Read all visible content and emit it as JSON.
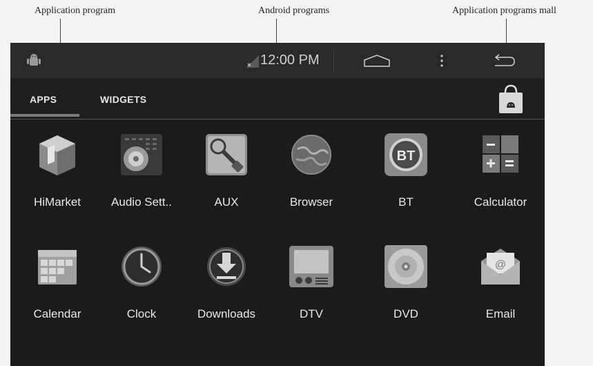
{
  "callouts": {
    "application_program": "Application program",
    "android_programs": "Android programs",
    "app_store": "Application programs mall"
  },
  "statusbar": {
    "time": "12:00 PM",
    "icons": [
      "android-debug-icon",
      "no-signal-icon",
      "home-icon",
      "menu-dots-icon",
      "back-icon"
    ]
  },
  "tabs": [
    {
      "label": "APPS",
      "selected": true
    },
    {
      "label": "WIDGETS",
      "selected": false
    }
  ],
  "store_icon": "shopping-bag-icon",
  "apps": [
    {
      "label": "HiMarket",
      "icon": "himarket-icon"
    },
    {
      "label": "Audio Sett..",
      "icon": "audio-settings-icon"
    },
    {
      "label": "AUX",
      "icon": "aux-icon"
    },
    {
      "label": "Browser",
      "icon": "browser-icon"
    },
    {
      "label": "BT",
      "icon": "bt-icon"
    },
    {
      "label": "Calculator",
      "icon": "calculator-icon"
    },
    {
      "label": "Calendar",
      "icon": "calendar-icon"
    },
    {
      "label": "Clock",
      "icon": "clock-icon"
    },
    {
      "label": "Downloads",
      "icon": "downloads-icon"
    },
    {
      "label": "DTV",
      "icon": "dtv-icon"
    },
    {
      "label": "DVD",
      "icon": "dvd-icon"
    },
    {
      "label": "Email",
      "icon": "email-icon"
    }
  ],
  "colors": {
    "screen_bg": "#1b1b1b",
    "text": "#e8e8e8",
    "tab_indicator": "#7a7a7a"
  }
}
